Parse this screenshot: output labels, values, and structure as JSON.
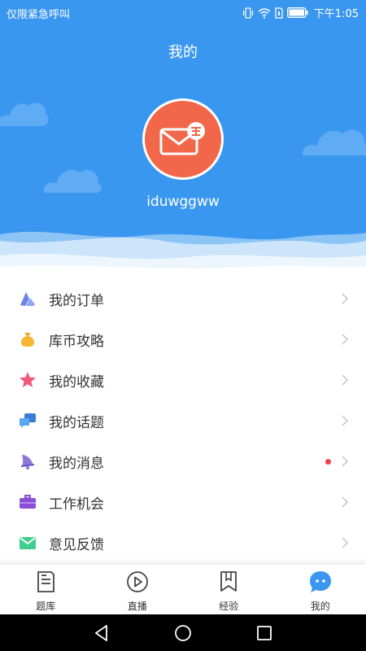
{
  "status_bar": {
    "carrier": "仅限紧急呼叫",
    "time": "下午1:05"
  },
  "header": {
    "title": "我的",
    "username": "iduwggww"
  },
  "menu": [
    {
      "label": "我的订单",
      "icon": "orders-icon"
    },
    {
      "label": "库币攻略",
      "icon": "coin-bag-icon"
    },
    {
      "label": "我的收藏",
      "icon": "star-icon"
    },
    {
      "label": "我的话题",
      "icon": "chat-bubbles-icon"
    },
    {
      "label": "我的消息",
      "icon": "bell-icon"
    },
    {
      "label": "工作机会",
      "icon": "briefcase-icon"
    },
    {
      "label": "意见反馈",
      "icon": "envelope-icon"
    }
  ],
  "tabs": [
    {
      "label": "题库",
      "icon": "question-bank-icon"
    },
    {
      "label": "直播",
      "icon": "play-icon"
    },
    {
      "label": "经验",
      "icon": "bookmark-icon"
    },
    {
      "label": "我的",
      "icon": "profile-chat-icon",
      "active": true
    }
  ],
  "colors": {
    "header_blue": "#3a97f0",
    "avatar_orange": "#f2674a",
    "notification_red": "#f0414a"
  }
}
